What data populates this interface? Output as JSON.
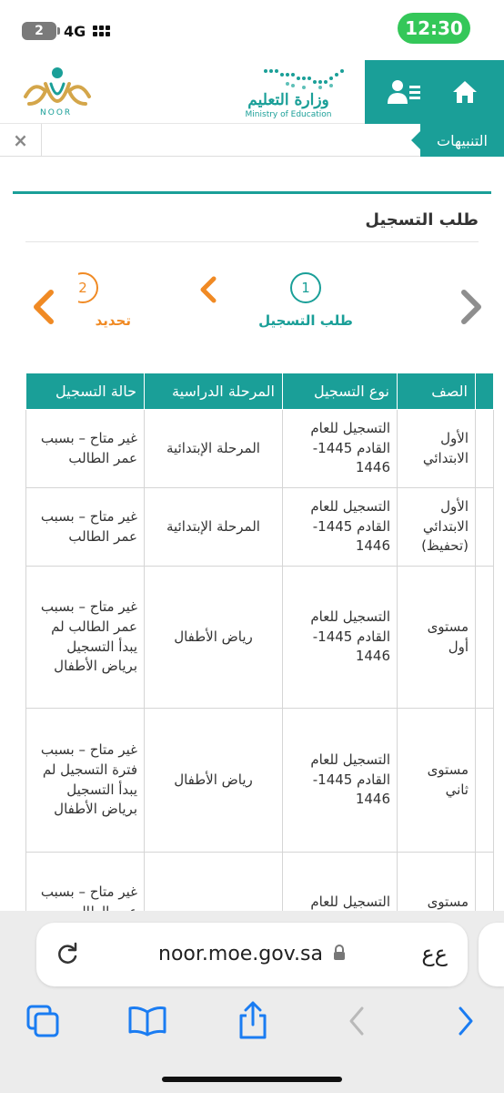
{
  "status_bar": {
    "time": "12:30",
    "battery": "2",
    "network": "4G"
  },
  "header": {
    "ministry_name": "وزارة التعليم",
    "ministry_sub": "Ministry of Education",
    "noor_label": "NOOR",
    "icons": [
      "home-icon",
      "user-list-icon"
    ]
  },
  "notifications": {
    "label": "التنبيهات",
    "close": "×"
  },
  "page": {
    "title": "طلب التسجيل",
    "steps": [
      {
        "number": "1",
        "label": "طلب التسجيل"
      },
      {
        "number": "2",
        "label": "تحديد"
      }
    ]
  },
  "table": {
    "headers": [
      "",
      "الصف",
      "نوع التسجيل",
      "المرحلة الدراسية",
      "حالة التسجيل"
    ],
    "rows": [
      {
        "grade": "الأول الابتدائي",
        "type": "التسجيل للعام القادم 1445-1446",
        "stage": "المرحلة الإبتدائية",
        "status": "غير متاح – بسبب عمر الطالب"
      },
      {
        "grade": "الأول الابتدائي (تحفيظ)",
        "type": "التسجيل للعام القادم 1445-1446",
        "stage": "المرحلة الإبتدائية",
        "status": "غير متاح – بسبب عمر الطالب"
      },
      {
        "grade": "مستوى أول",
        "type": "التسجيل للعام القادم 1445-1446",
        "stage": "رياض الأطفال",
        "status": "غير متاح – بسبب عمر الطالب لم يبدأ التسجيل برياض الأطفال"
      },
      {
        "grade": "مستوى ثاني",
        "type": "التسجيل للعام القادم 1445-1446",
        "stage": "رياض الأطفال",
        "status": "غير متاح – بسبب فترة التسجيل لم يبدأ التسجيل برياض الأطفال"
      },
      {
        "grade": "مستوى",
        "type": "التسجيل للعام",
        "stage": "",
        "status": "غير متاح – بسبب عمر الطالب"
      }
    ]
  },
  "browser": {
    "url": "noor.moe.gov.sa",
    "aa_label": "ﻉﻉ"
  },
  "colors": {
    "teal": "#1a9f98",
    "orange": "#f08a24",
    "gray_arrow": "#8e8e8e",
    "ios_blue": "#1a7cf2"
  }
}
